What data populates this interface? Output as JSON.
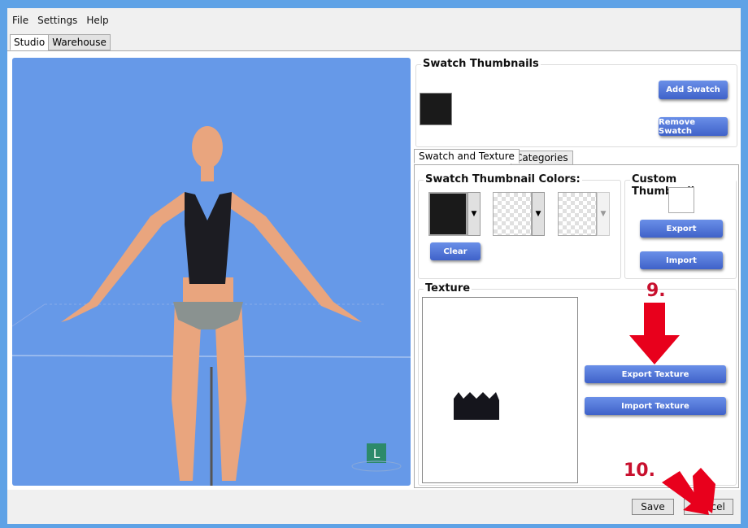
{
  "menu": [
    "File",
    "Settings",
    "Help"
  ],
  "tabs": [
    "Studio",
    "Warehouse"
  ],
  "swatch_thumbnails": {
    "title": "Swatch Thumbnails",
    "add": "Add Swatch",
    "remove": "Remove Swatch",
    "swatch_color": "#1a1a1a"
  },
  "subtabs": [
    "Swatch and Texture",
    "Categories"
  ],
  "thumbnail_colors": {
    "title": "Swatch Thumbnail Colors:",
    "clear": "Clear",
    "colors": [
      "#1a1a1a",
      "transparent",
      "transparent"
    ]
  },
  "custom_thumbnail": {
    "title": "Custom Thumbnail",
    "export": "Export",
    "import": "Import"
  },
  "texture": {
    "title": "Texture",
    "export": "Export Texture",
    "import": "Import Texture"
  },
  "annotations": {
    "step9": "9.",
    "step10": "10.",
    "color": "#e8001c"
  },
  "viewport": {
    "badge": "L",
    "background": "#6699e8"
  },
  "footer": {
    "save": "Save",
    "cancel": "Cancel"
  }
}
